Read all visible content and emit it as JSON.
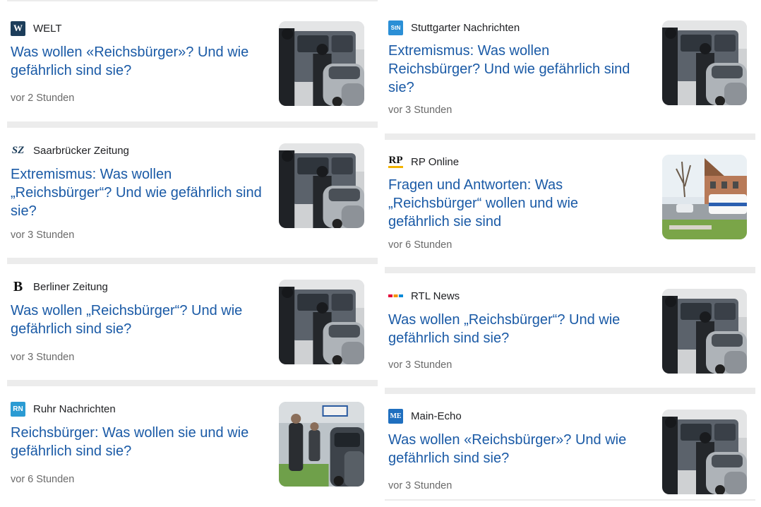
{
  "left_column": [
    {
      "source": "WELT",
      "logo_text": "W",
      "headline": "Was wollen «Reichsbürger»? Und wie gefährlich sind sie?",
      "time": "vor 2 Stunden",
      "thumb_icon": "police-van-photo"
    },
    {
      "source": "Saarbrücker Zeitung",
      "logo_text": "SZ",
      "headline": "Extremismus: Was wollen „Reichsbürger“? Und wie gefährlich sind sie?",
      "time": "vor 3 Stunden",
      "thumb_icon": "police-van-photo"
    },
    {
      "source": "Berliner Zeitung",
      "logo_text": "B",
      "headline": "Was wollen „Reichsbürger“? Und wie gefährlich sind sie?",
      "time": "vor 3 Stunden",
      "thumb_icon": "police-van-photo"
    },
    {
      "source": "Ruhr Nachrichten",
      "logo_text": "RN",
      "headline": "Reichsbürger: Was wollen sie und wie gefährlich sind sie?",
      "time": "vor 6 Stunden",
      "thumb_icon": "police-street-photo"
    }
  ],
  "right_column": [
    {
      "source": "Stuttgarter Nachrichten",
      "logo_text": "StN",
      "headline": "Extremismus: Was wollen Reichsbürger? Und wie gefährlich sind sie?",
      "time": "vor 3 Stunden",
      "thumb_icon": "police-van-photo"
    },
    {
      "source": "RP Online",
      "logo_text": "RP",
      "headline": "Fragen und Antworten: Was „Reichsbürger“ wollen und wie gefährlich sie sind",
      "time": "vor 6 Stunden",
      "thumb_icon": "street-police-bus-photo"
    },
    {
      "source": "RTL News",
      "logo_text": "",
      "headline": "Was wollen „Reichsbürger“? Und wie gefährlich sind sie?",
      "time": "vor 3 Stunden",
      "thumb_icon": "police-van-photo"
    },
    {
      "source": "Main-Echo",
      "logo_text": "ME",
      "headline": "Was wollen «Reichsbürger»? Und wie gefährlich sind sie?",
      "time": "vor 3 Stunden",
      "thumb_icon": "police-van-photo"
    }
  ],
  "colors": {
    "headline": "#1a5aa6",
    "time": "#6a6a6a",
    "source": "#202124",
    "separator": "#ececec"
  }
}
